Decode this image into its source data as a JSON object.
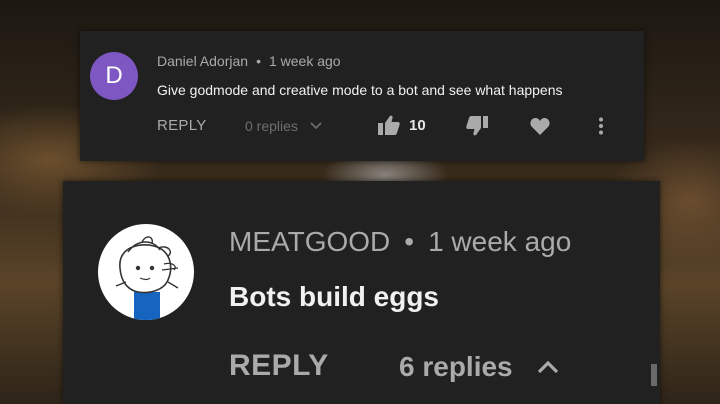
{
  "comment_top": {
    "avatar_letter": "D",
    "avatar_color": "#7e57c2",
    "author": "Daniel Adorjan",
    "separator": "•",
    "time": "1 week ago",
    "text": "Give godmode and creative mode to a bot and see what happens",
    "reply_label": "REPLY",
    "replies_label": "0 replies",
    "like_count": "10",
    "icons": [
      "chevron-down-icon",
      "thumbs-up-icon",
      "thumbs-down-icon",
      "heart-icon",
      "more-vert-icon"
    ]
  },
  "comment_bottom": {
    "author": "MEATGOOD",
    "separator": "•",
    "time": "1 week ago",
    "text": "Bots build eggs",
    "reply_label": "REPLY",
    "replies_label": "6 replies",
    "icons": [
      "chevron-up-icon"
    ]
  },
  "colors": {
    "card_bg": "#212121",
    "meta_text": "#aaaaaa",
    "body_text": "#f1f1f1"
  }
}
